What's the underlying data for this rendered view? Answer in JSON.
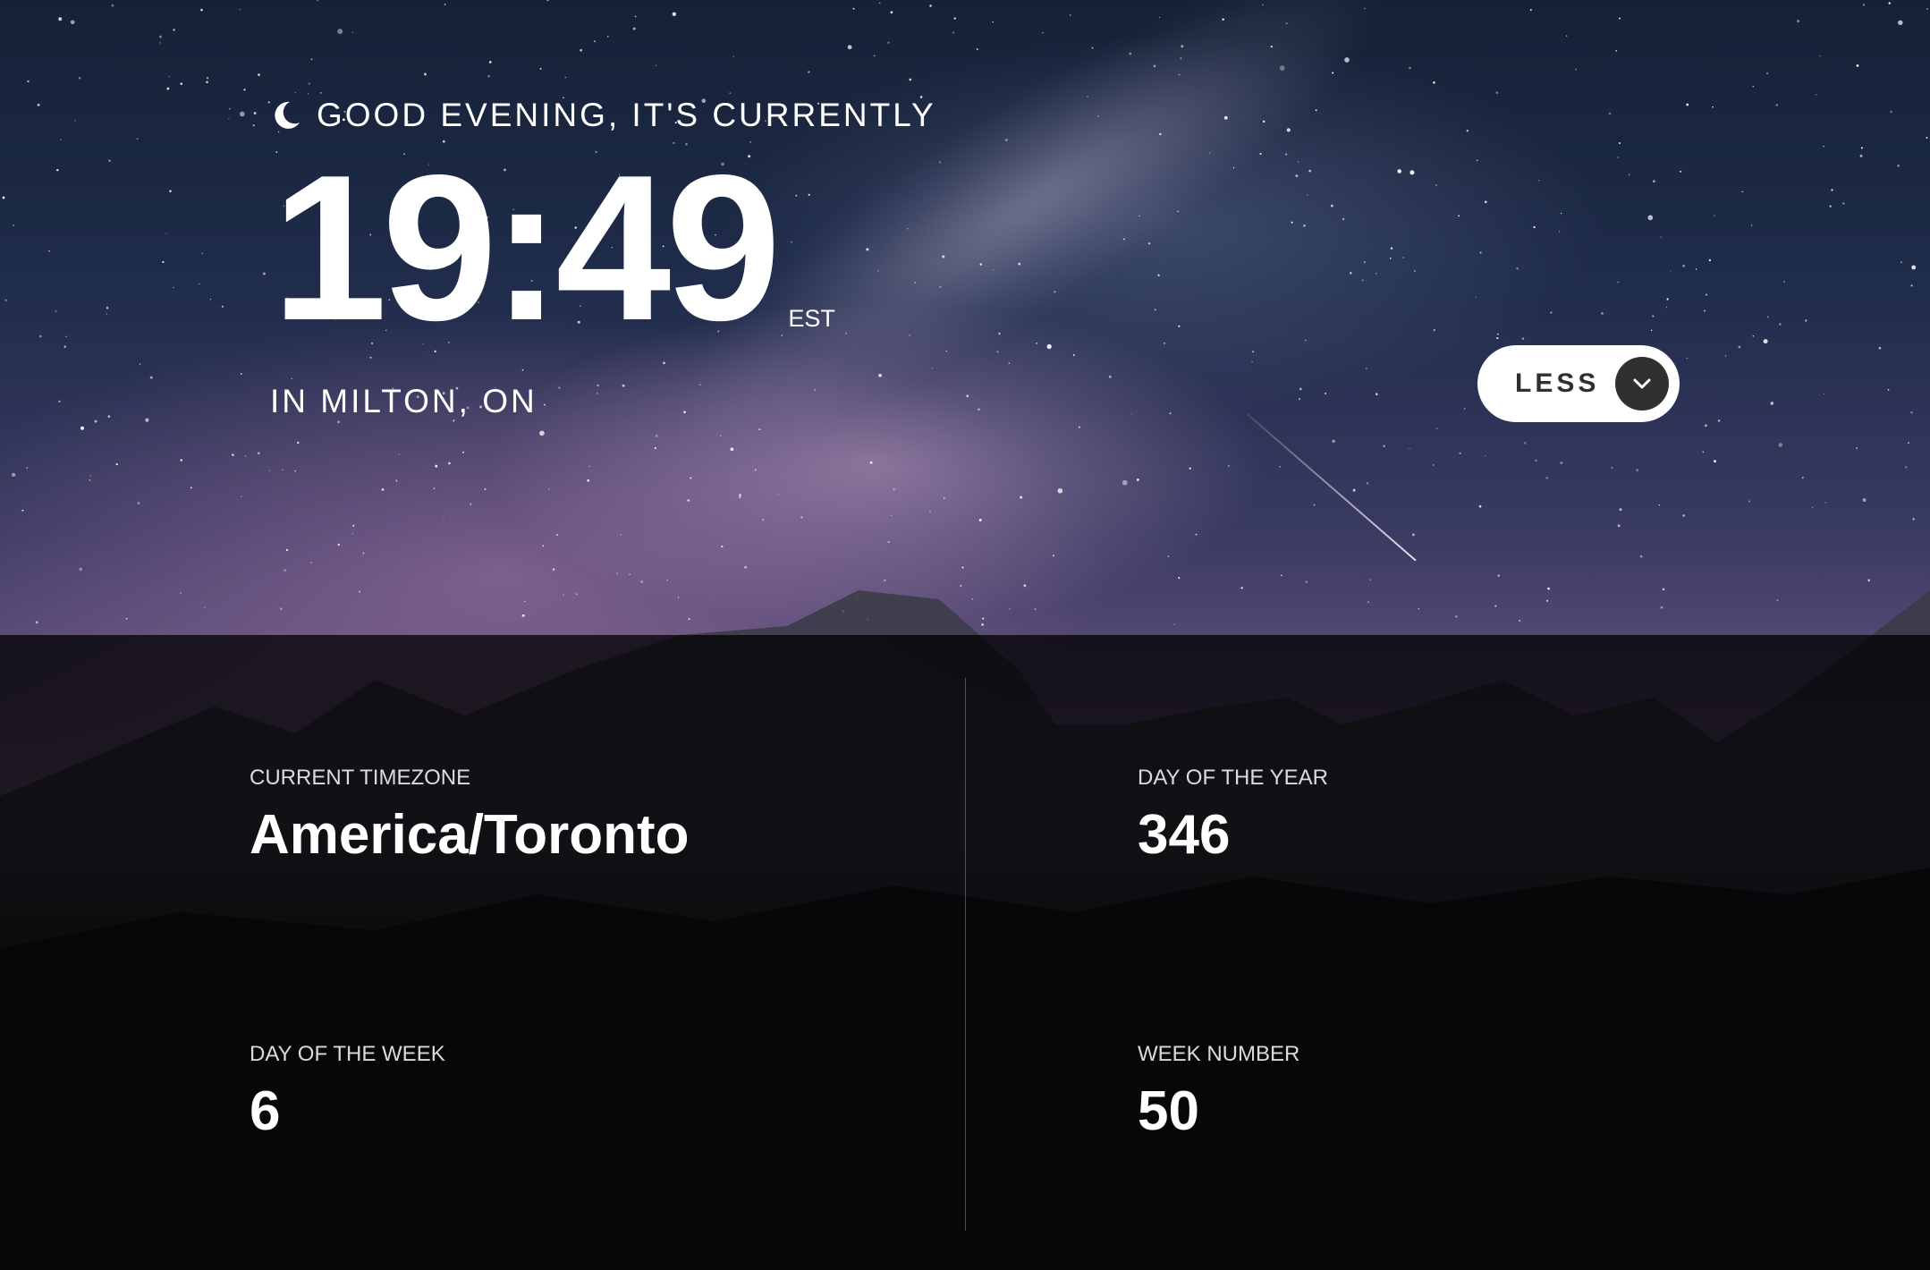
{
  "greeting": {
    "icon": "moon-icon",
    "text": "GOOD EVENING, IT'S CURRENTLY"
  },
  "clock": {
    "time": "19:49",
    "abbreviation": "EST"
  },
  "location": "IN MILTON, ON",
  "toggle": {
    "label": "LESS",
    "icon": "chevron-down-icon"
  },
  "details": {
    "timezone": {
      "label": "CURRENT TIMEZONE",
      "value": "America/Toronto"
    },
    "day_of_year": {
      "label": "DAY OF THE YEAR",
      "value": "346"
    },
    "day_of_week": {
      "label": "DAY OF THE WEEK",
      "value": "6"
    },
    "week_number": {
      "label": "WEEK NUMBER",
      "value": "50"
    }
  },
  "colors": {
    "button_bg": "#ffffff",
    "button_text": "#303030",
    "panel_overlay": "#000000"
  }
}
